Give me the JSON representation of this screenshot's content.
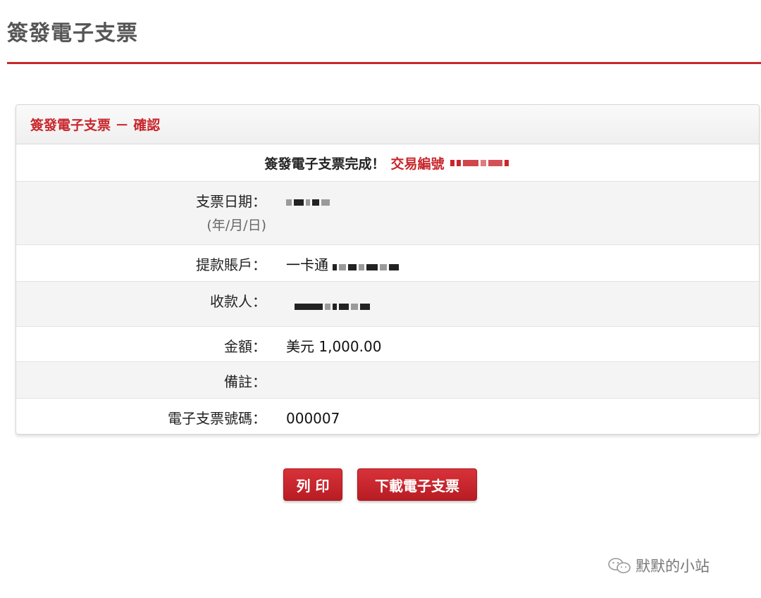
{
  "page": {
    "title": "簽發電子支票"
  },
  "panel": {
    "heading": "簽發電子支票 － 確認",
    "complete_text": "簽發電子支票完成！",
    "txn_label": "交易編號"
  },
  "rows": [
    {
      "label": "支票日期：",
      "sublabel": "(年/月/日)"
    },
    {
      "label": "提款賬戶：",
      "value_prefix": "一卡通"
    },
    {
      "label": "收款人："
    },
    {
      "label": "金額：",
      "value": "美元  1,000.00"
    },
    {
      "label": "備註："
    },
    {
      "label": "電子支票號碼：",
      "value": "000007"
    }
  ],
  "buttons": {
    "print": "列 印",
    "download": "下載電子支票"
  },
  "watermark": {
    "text": "默默的小站",
    "icon": "wechat-icon"
  },
  "colors": {
    "accent": "#c8262c",
    "rule": "#c8262c"
  }
}
